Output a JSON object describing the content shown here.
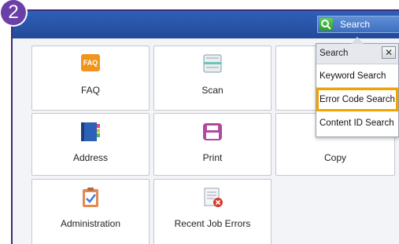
{
  "step": {
    "number": "2"
  },
  "header": {
    "search_label": "Search"
  },
  "tiles": [
    {
      "label": "FAQ",
      "icon": "faq-icon",
      "icon_text": "FAQ"
    },
    {
      "label": "Scan",
      "icon": "scan-icon"
    },
    {
      "label": "Address",
      "icon": "address-book-icon"
    },
    {
      "label": "Print",
      "icon": "printer-icon"
    },
    {
      "label": "Copy",
      "icon": "copy-icon"
    },
    {
      "label": "Administration",
      "icon": "clipboard-check-icon"
    },
    {
      "label": "Recent Job Errors",
      "icon": "error-list-icon"
    }
  ],
  "search_popup": {
    "title": "Search",
    "close": "✕",
    "items": [
      {
        "label": "Keyword Search"
      },
      {
        "label": "Error Code Search",
        "highlighted": true
      },
      {
        "label": "Content ID Search"
      }
    ]
  },
  "colors": {
    "accent": "#2a55a8",
    "highlight": "#f2a300",
    "badge": "#6a3fa8"
  }
}
